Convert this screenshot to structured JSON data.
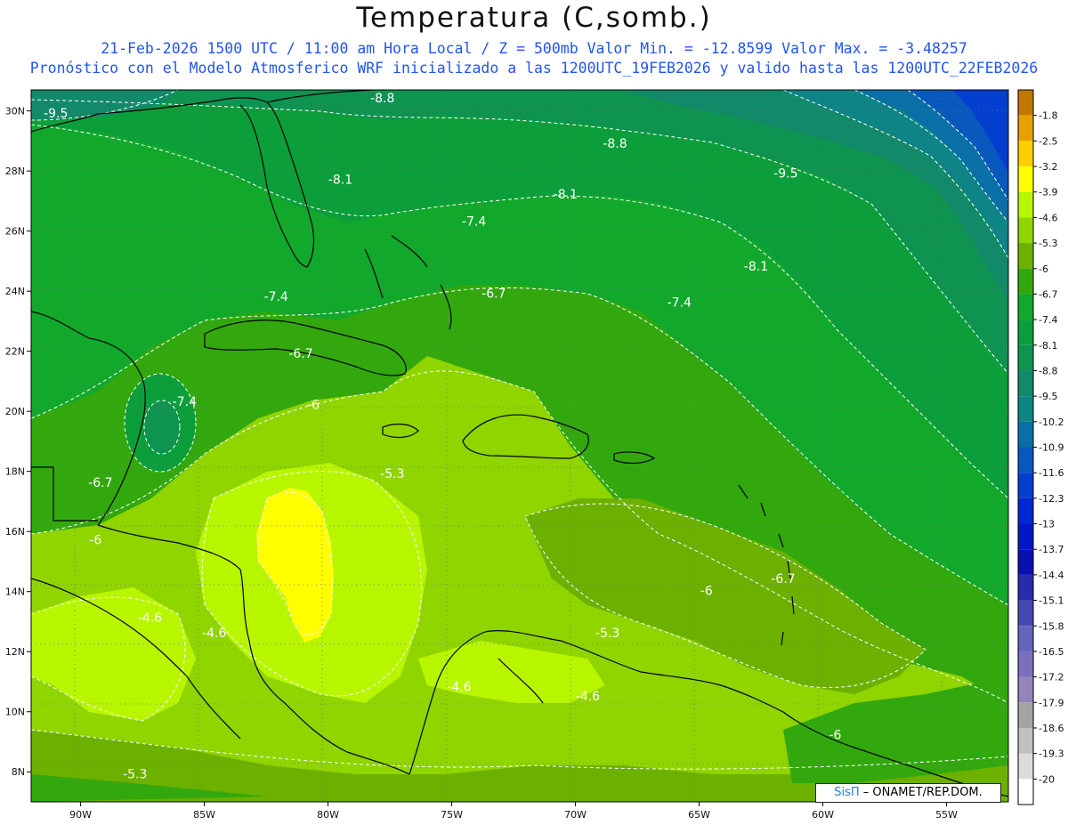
{
  "title": "Temperatura (C,somb.)",
  "subtitle_1": "21-Feb-2026  1500 UTC / 11:00 am Hora Local / Z = 500mb  Valor Min. = -12.8599  Valor Max. = -3.48257",
  "subtitle_2": "Pronóstico con el Modelo Atmosferico WRF inicializado a las 1200UTC_19FEB2026 y valido hasta las  1200UTC_22FEB2026",
  "map": {
    "lon_range": [
      -92,
      -52.5
    ],
    "lat_range": [
      7,
      30.7
    ],
    "lon_ticks": [
      {
        "value": -90,
        "label": "90W"
      },
      {
        "value": -85,
        "label": "85W"
      },
      {
        "value": -80,
        "label": "80W"
      },
      {
        "value": -75,
        "label": "75W"
      },
      {
        "value": -70,
        "label": "70W"
      },
      {
        "value": -65,
        "label": "65W"
      },
      {
        "value": -60,
        "label": "60W"
      },
      {
        "value": -55,
        "label": "55W"
      }
    ],
    "lat_ticks": [
      {
        "value": 30,
        "label": "30N"
      },
      {
        "value": 28,
        "label": "28N"
      },
      {
        "value": 26,
        "label": "26N"
      },
      {
        "value": 24,
        "label": "24N"
      },
      {
        "value": 22,
        "label": "22N"
      },
      {
        "value": 20,
        "label": "20N"
      },
      {
        "value": 18,
        "label": "18N"
      },
      {
        "value": 16,
        "label": "16N"
      },
      {
        "value": 14,
        "label": "14N"
      },
      {
        "value": 12,
        "label": "12N"
      },
      {
        "value": 10,
        "label": "10N"
      },
      {
        "value": 8,
        "label": "8N"
      }
    ],
    "contour_labels": [
      {
        "text": "-9.5",
        "lon": -91.0,
        "lat": 29.9
      },
      {
        "text": "-8.8",
        "lon": -77.8,
        "lat": 30.4
      },
      {
        "text": "-8.8",
        "lon": -68.4,
        "lat": 28.9
      },
      {
        "text": "-9.5",
        "lon": -61.5,
        "lat": 27.9
      },
      {
        "text": "-8.1",
        "lon": -79.5,
        "lat": 27.7
      },
      {
        "text": "-8.1",
        "lon": -70.4,
        "lat": 27.2
      },
      {
        "text": "-8.1",
        "lon": -62.7,
        "lat": 24.8
      },
      {
        "text": "-7.4",
        "lon": -74.1,
        "lat": 26.3
      },
      {
        "text": "-7.4",
        "lon": -82.1,
        "lat": 23.8
      },
      {
        "text": "-7.4",
        "lon": -65.8,
        "lat": 23.6
      },
      {
        "text": "-7.4",
        "lon": -85.8,
        "lat": 20.3
      },
      {
        "text": "-6.7",
        "lon": -73.3,
        "lat": 23.9
      },
      {
        "text": "-6.7",
        "lon": -81.1,
        "lat": 21.9
      },
      {
        "text": "-6.7",
        "lon": -89.2,
        "lat": 17.6
      },
      {
        "text": "-6.7",
        "lon": -61.6,
        "lat": 14.4
      },
      {
        "text": "-6",
        "lon": -80.6,
        "lat": 20.2
      },
      {
        "text": "-6",
        "lon": -89.4,
        "lat": 15.7
      },
      {
        "text": "-6",
        "lon": -64.7,
        "lat": 14.0
      },
      {
        "text": "-6",
        "lon": -59.5,
        "lat": 9.2
      },
      {
        "text": "-5.3",
        "lon": -77.4,
        "lat": 17.9
      },
      {
        "text": "-5.3",
        "lon": -68.7,
        "lat": 12.6
      },
      {
        "text": "-5.3",
        "lon": -87.8,
        "lat": 7.9
      },
      {
        "text": "-4.6",
        "lon": -87.2,
        "lat": 13.1
      },
      {
        "text": "-4.6",
        "lon": -84.6,
        "lat": 12.6
      },
      {
        "text": "-4.6",
        "lon": -74.7,
        "lat": 10.8
      },
      {
        "text": "-4.6",
        "lon": -69.5,
        "lat": 10.5
      }
    ]
  },
  "colorbar": {
    "levels": [
      {
        "label": "-1.8",
        "color": "#c07800"
      },
      {
        "label": "-2.5",
        "color": "#e8a000"
      },
      {
        "label": "-3.2",
        "color": "#ffd000"
      },
      {
        "label": "-3.9",
        "color": "#ffff00"
      },
      {
        "label": "-4.6",
        "color": "#b8f600"
      },
      {
        "label": "-5.3",
        "color": "#90d400"
      },
      {
        "label": "-6",
        "color": "#6cb000"
      },
      {
        "label": "-6.7",
        "color": "#32a80e"
      },
      {
        "label": "-7.4",
        "color": "#12a82c"
      },
      {
        "label": "-8.1",
        "color": "#0c9e3a"
      },
      {
        "label": "-8.8",
        "color": "#0e9350"
      },
      {
        "label": "-9.5",
        "color": "#128a6a"
      },
      {
        "label": "-10.2",
        "color": "#0e8487"
      },
      {
        "label": "-10.9",
        "color": "#0a6fa6"
      },
      {
        "label": "-11.6",
        "color": "#0858be"
      },
      {
        "label": "-12.3",
        "color": "#043ecf"
      },
      {
        "label": "-13",
        "color": "#0028d2"
      },
      {
        "label": "-13.7",
        "color": "#0018c4"
      },
      {
        "label": "-14.4",
        "color": "#0a10b0"
      },
      {
        "label": "-15.1",
        "color": "#2a2aae"
      },
      {
        "label": "-15.8",
        "color": "#4848b4"
      },
      {
        "label": "-16.5",
        "color": "#6464ba"
      },
      {
        "label": "-17.2",
        "color": "#7c70bc"
      },
      {
        "label": "-17.9",
        "color": "#9484bc"
      },
      {
        "label": "-18.6",
        "color": "#a4a4a4"
      },
      {
        "label": "-19.3",
        "color": "#c0c0c0"
      },
      {
        "label": "-20",
        "color": "#dcdcdc"
      },
      {
        "label": "",
        "color": "#ffffff"
      }
    ]
  },
  "credit": {
    "logo": "SisΠ",
    "text": " – ONAMET/REP.DOM."
  },
  "colors": {
    "contour": "#ffffff",
    "coast": "#000000",
    "axis_text": "#111111"
  }
}
